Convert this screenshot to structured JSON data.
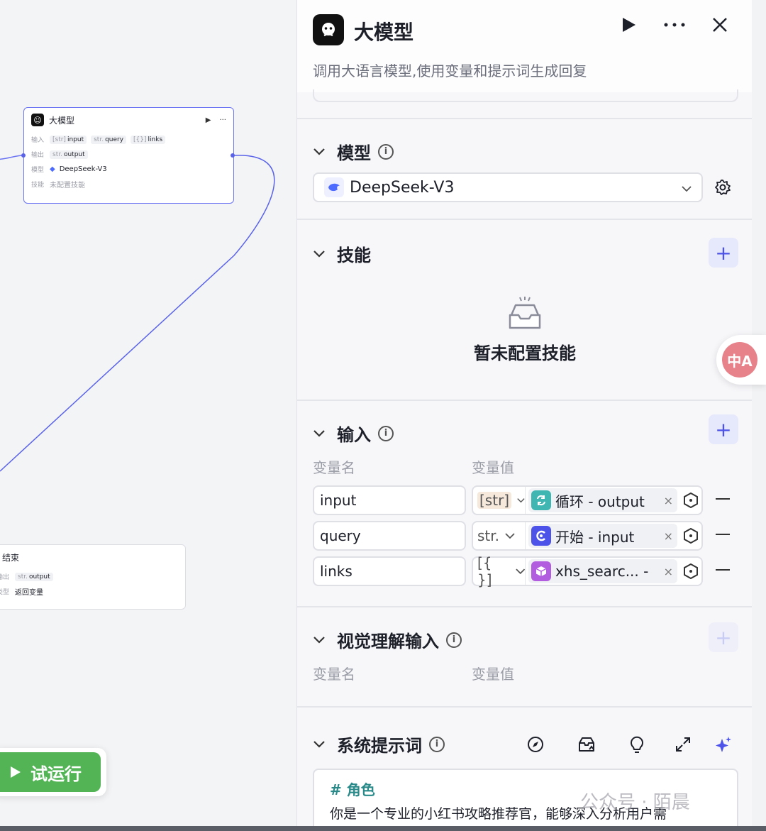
{
  "canvas": {
    "llm_node": {
      "title": "大模型",
      "run_glyph": "▶",
      "more_glyph": "···",
      "input_label": "输入",
      "inputs": [
        {
          "type": "[str]",
          "name": "input"
        },
        {
          "type": "str.",
          "name": "query"
        },
        {
          "type": "[{}]",
          "name": "links"
        }
      ],
      "output_label": "输出",
      "output": {
        "type": "str.",
        "name": "output"
      },
      "model_label": "模型",
      "model": "DeepSeek-V3",
      "skill_label": "技能",
      "skill_value": "未配置技能"
    },
    "end_node": {
      "title": "结束",
      "output_label": "输出",
      "output": {
        "type": "str.",
        "name": "output"
      },
      "type_label": "类型",
      "type_value": "返回变量"
    },
    "run_button": {
      "label": "试运行",
      "icon": "play-icon"
    }
  },
  "panel": {
    "title": "大模型",
    "description": "调用大语言模型,使用变量和提示词生成回复",
    "actions": [
      "play-icon",
      "more-icon",
      "close-icon"
    ],
    "model_section": {
      "title": "模型",
      "selected_model": "DeepSeek-V3"
    },
    "skills_section": {
      "title": "技能",
      "empty_text": "暂未配置技能"
    },
    "input_section": {
      "title": "输入",
      "col_name": "变量名",
      "col_value": "变量值",
      "rows": [
        {
          "name": "input",
          "type": "[str]",
          "ref": "循环 - output",
          "ref_icon": "loop-icon",
          "ref_color": "#3fb6b2"
        },
        {
          "name": "query",
          "type": "str.",
          "ref": "开始 - input",
          "ref_icon": "start-icon",
          "ref_color": "#4d53e8"
        },
        {
          "name": "links",
          "type": "[{ }]",
          "ref": "xhs_searc... -",
          "ref_icon": "plugin-cube-icon",
          "ref_color": "#b25ce0"
        }
      ]
    },
    "visual_section": {
      "title": "视觉理解输入",
      "col_name": "变量名",
      "col_value": "变量值"
    },
    "prompt_section": {
      "title": "系统提示词",
      "tools": [
        "compass-icon",
        "library-upload-icon",
        "bulb-icon",
        "expand-icon",
        "ai-sparkle-icon"
      ],
      "heading": "# 角色",
      "body": "你是一个专业的小红书攻略推荐官，能够深入分析用户需"
    }
  },
  "overlay": {
    "translate_label": "中A",
    "watermark": "公众号 · 陌晨"
  },
  "colors": {
    "accent": "#4d53e8",
    "run_green": "#52b455",
    "edge": "#5a63e8"
  }
}
